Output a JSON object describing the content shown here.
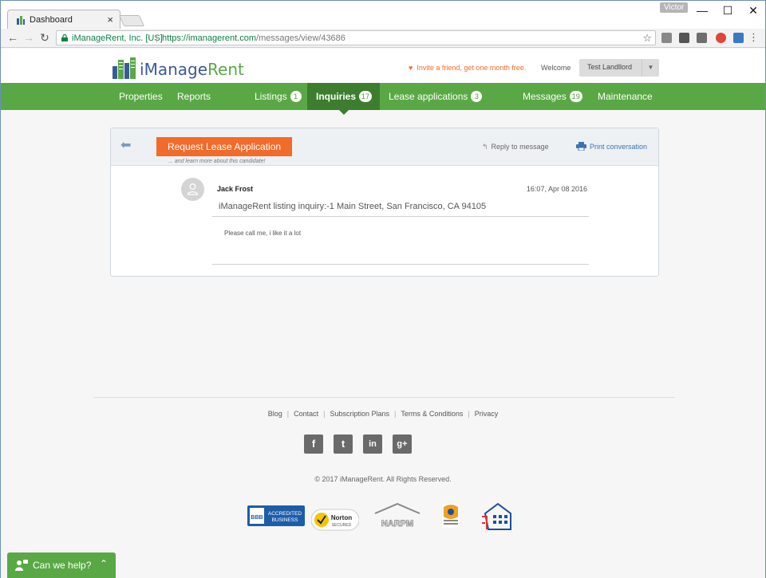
{
  "browser": {
    "tab_title": "Dashboard",
    "tab_close": "×",
    "profile_name": "Victor",
    "window_buttons": {
      "minimize": "—",
      "maximize": "☐",
      "close": "✕"
    },
    "secure_label": "iManageRent, Inc. [US]",
    "url_scheme_host": "https://imanagerent.com",
    "url_path": "/messages/view/43686"
  },
  "site": {
    "logo_i": "i",
    "logo_manage": "Manage",
    "logo_rent": "Rent",
    "invite_text": "Invite a friend, get one month free.",
    "welcome": "Welcome",
    "user_name": "Test Landllord",
    "nav": [
      {
        "label": "Properties",
        "count": null
      },
      {
        "label": "Reports",
        "count": null
      },
      {
        "label": "Listings",
        "count": "1"
      },
      {
        "label": "Inquiries",
        "count": "17"
      },
      {
        "label": "Lease applications",
        "count": "3"
      },
      {
        "label": "Messages",
        "count": "19"
      },
      {
        "label": "Maintenance",
        "count": null
      }
    ]
  },
  "message": {
    "request_button": "Request Lease Application",
    "request_sub": "... and learn more about this candidate!",
    "reply_label": "Reply to message",
    "print_label": "Print conversation",
    "sender": "Jack Frost",
    "time": "16:07, Apr 08 2016",
    "subject": "iManageRent listing inquiry:-1 Main Street, San Francisco, CA 94105",
    "body": "Please call me, i like it a lot"
  },
  "footer": {
    "links": [
      "Blog",
      "Contact",
      "Subscription Plans",
      "Terms & Conditions",
      "Privacy"
    ],
    "social": [
      "f",
      "t",
      "in",
      "g+"
    ],
    "copyright": "© 2017 iManageRent. All Rights Reserved.",
    "badges": {
      "bbb_line1": "ACCREDITED",
      "bbb_line2": "BUSINESS",
      "norton": "Norton",
      "norton_sub": "SECURED",
      "narpm": "NARPM"
    }
  },
  "chat": {
    "label": "Can we help?"
  },
  "colors": {
    "brand_green": "#5aa845",
    "nav_active": "#3d7d2e",
    "accent_orange": "#f26b2a",
    "link_blue": "#3a74b5"
  }
}
